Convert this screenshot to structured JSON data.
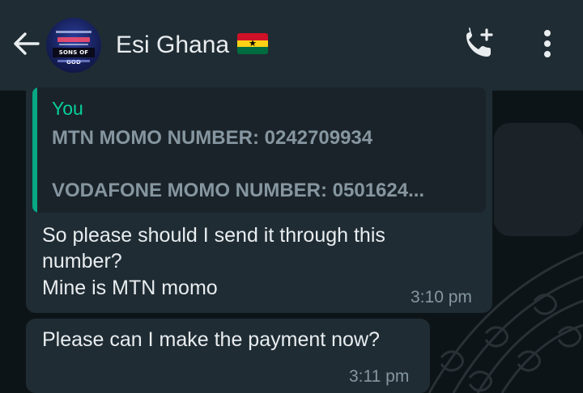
{
  "header": {
    "contact_name": "Esi Ghana",
    "avatar_text": "SONS OF GOD",
    "icons": {
      "back": "arrow-left-icon",
      "call": "add-call-icon",
      "menu": "more-vertical-icon",
      "flag": "ghana-flag-icon"
    }
  },
  "messages": [
    {
      "quoted": {
        "author": "You",
        "line1": "MTN MOMO NUMBER: 0242709934",
        "line2": "VODAFONE MOMO NUMBER: 0501624..."
      },
      "lines": [
        "So please should I send it through this",
        "number?",
        "Mine is MTN momo"
      ],
      "time": "3:10 pm"
    },
    {
      "lines": [
        "Please can I make the payment now?"
      ],
      "time": "3:11 pm"
    }
  ],
  "colors": {
    "header_bg": "#1f2c34",
    "bubble_bg": "#1f2c34",
    "quote_accent": "#06a884",
    "text_primary": "#e9edef",
    "text_secondary": "#8696a0"
  }
}
